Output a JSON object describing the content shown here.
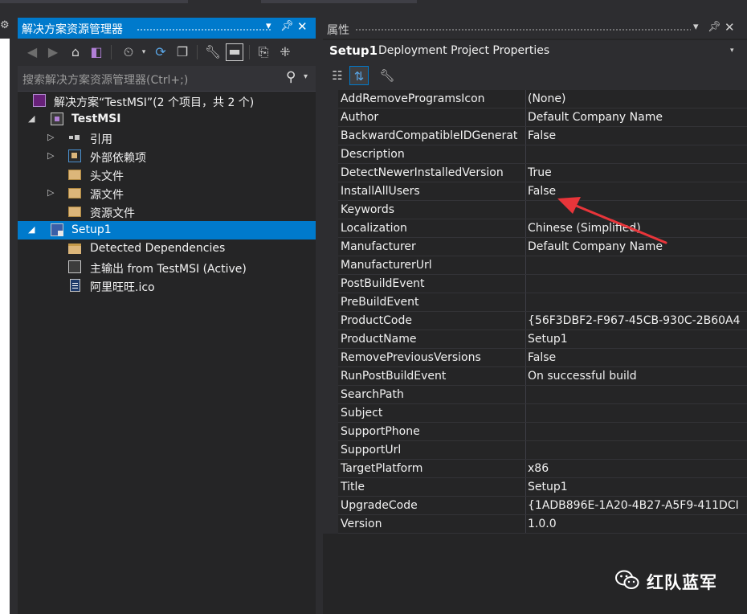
{
  "solution_explorer": {
    "title": "解决方案资源管理器",
    "search_placeholder": "搜索解决方案资源管理器(Ctrl+;)",
    "tree": [
      {
        "label": "解决方案“TestMSI”(2 个项目，共 2 个)",
        "icon": "solution-icon"
      },
      {
        "label": "TestMSI",
        "icon": "cpp-project-icon"
      },
      {
        "label": "引用",
        "icon": "references-icon"
      },
      {
        "label": "外部依赖项",
        "icon": "external-dependencies-icon"
      },
      {
        "label": "头文件",
        "icon": "filter-folder-icon"
      },
      {
        "label": "源文件",
        "icon": "filter-folder-icon"
      },
      {
        "label": "资源文件",
        "icon": "filter-folder-icon"
      },
      {
        "label": "Setup1",
        "icon": "setup-project-icon"
      },
      {
        "label": "Detected Dependencies",
        "icon": "folder-icon"
      },
      {
        "label": "主输出 from TestMSI (Active)",
        "icon": "primary-output-icon"
      },
      {
        "label": "阿里旺旺.ico",
        "icon": "file-icon"
      }
    ]
  },
  "properties": {
    "title": "属性",
    "object_name": "Setup1",
    "object_type": "Deployment Project Properties",
    "rows": [
      {
        "name": "AddRemoveProgramsIcon",
        "value": "(None)"
      },
      {
        "name": "Author",
        "value": "Default Company Name"
      },
      {
        "name": "BackwardCompatibleIDGenerat",
        "value": "False"
      },
      {
        "name": "Description",
        "value": ""
      },
      {
        "name": "DetectNewerInstalledVersion",
        "value": "True"
      },
      {
        "name": "InstallAllUsers",
        "value": "False"
      },
      {
        "name": "Keywords",
        "value": ""
      },
      {
        "name": "Localization",
        "value": "Chinese (Simplified)"
      },
      {
        "name": "Manufacturer",
        "value": "Default Company Name"
      },
      {
        "name": "ManufacturerUrl",
        "value": ""
      },
      {
        "name": "PostBuildEvent",
        "value": ""
      },
      {
        "name": "PreBuildEvent",
        "value": ""
      },
      {
        "name": "ProductCode",
        "value": "{56F3DBF2-F967-45CB-930C-2B60A4"
      },
      {
        "name": "ProductName",
        "value": "Setup1"
      },
      {
        "name": "RemovePreviousVersions",
        "value": "False"
      },
      {
        "name": "RunPostBuildEvent",
        "value": "On successful build"
      },
      {
        "name": "SearchPath",
        "value": ""
      },
      {
        "name": "Subject",
        "value": ""
      },
      {
        "name": "SupportPhone",
        "value": ""
      },
      {
        "name": "SupportUrl",
        "value": ""
      },
      {
        "name": "TargetPlatform",
        "value": "x86"
      },
      {
        "name": "Title",
        "value": "Setup1"
      },
      {
        "name": "UpgradeCode",
        "value": "{1ADB896E-1A20-4B27-A5F9-411DCI"
      },
      {
        "name": "Version",
        "value": "1.0.0"
      }
    ]
  },
  "watermark": {
    "text": "红队蓝军"
  },
  "colors": {
    "accent": "#007acc",
    "annotation_arrow": "#e8353a"
  }
}
